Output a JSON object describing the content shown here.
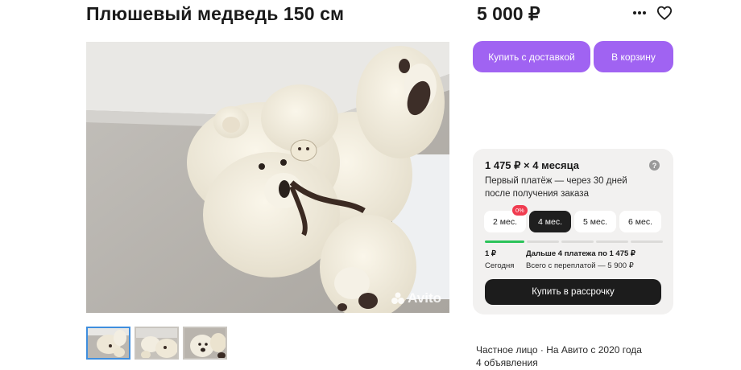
{
  "listing": {
    "title": "Плюшевый медведь 150 см",
    "price": "5 000 ₽"
  },
  "header_actions": {
    "more_icon": "more-dots-icon",
    "favorite_icon": "heart-icon"
  },
  "gallery": {
    "watermark": "Avito",
    "thumbnail_count": 3,
    "active_thumbnail": 1
  },
  "actions": {
    "buy_with_delivery": "Купить с доставкой",
    "add_to_cart": "В корзину"
  },
  "installments": {
    "title": "1 475 ₽ × 4 месяца",
    "description": "Первый платёж — через 30 дней после получения заказа",
    "help": "?",
    "tabs": [
      {
        "label": "2 мес.",
        "badge": "0%"
      },
      {
        "label": "4 мес."
      },
      {
        "label": "5 мес."
      },
      {
        "label": "6 мес."
      }
    ],
    "selected_tab": "4 мес.",
    "first_payment": {
      "amount": "1 ₽",
      "when": "Сегодня"
    },
    "later_payments": {
      "amount": "Дальше 4 платежа по 1 475 ₽",
      "total": "Всего с переплатой — 5 900 ₽"
    },
    "buy_button": "Купить в рассрочку"
  },
  "seller": {
    "info": "Частное лицо · На Авито с 2020 года",
    "listings": "4 объявления"
  },
  "colors": {
    "accent": "#a063f2",
    "dark_button": "#1c1c1c",
    "badge_red": "#f03c50",
    "progress_green": "#2cc35a",
    "panel_bg": "#f2f1f0"
  }
}
